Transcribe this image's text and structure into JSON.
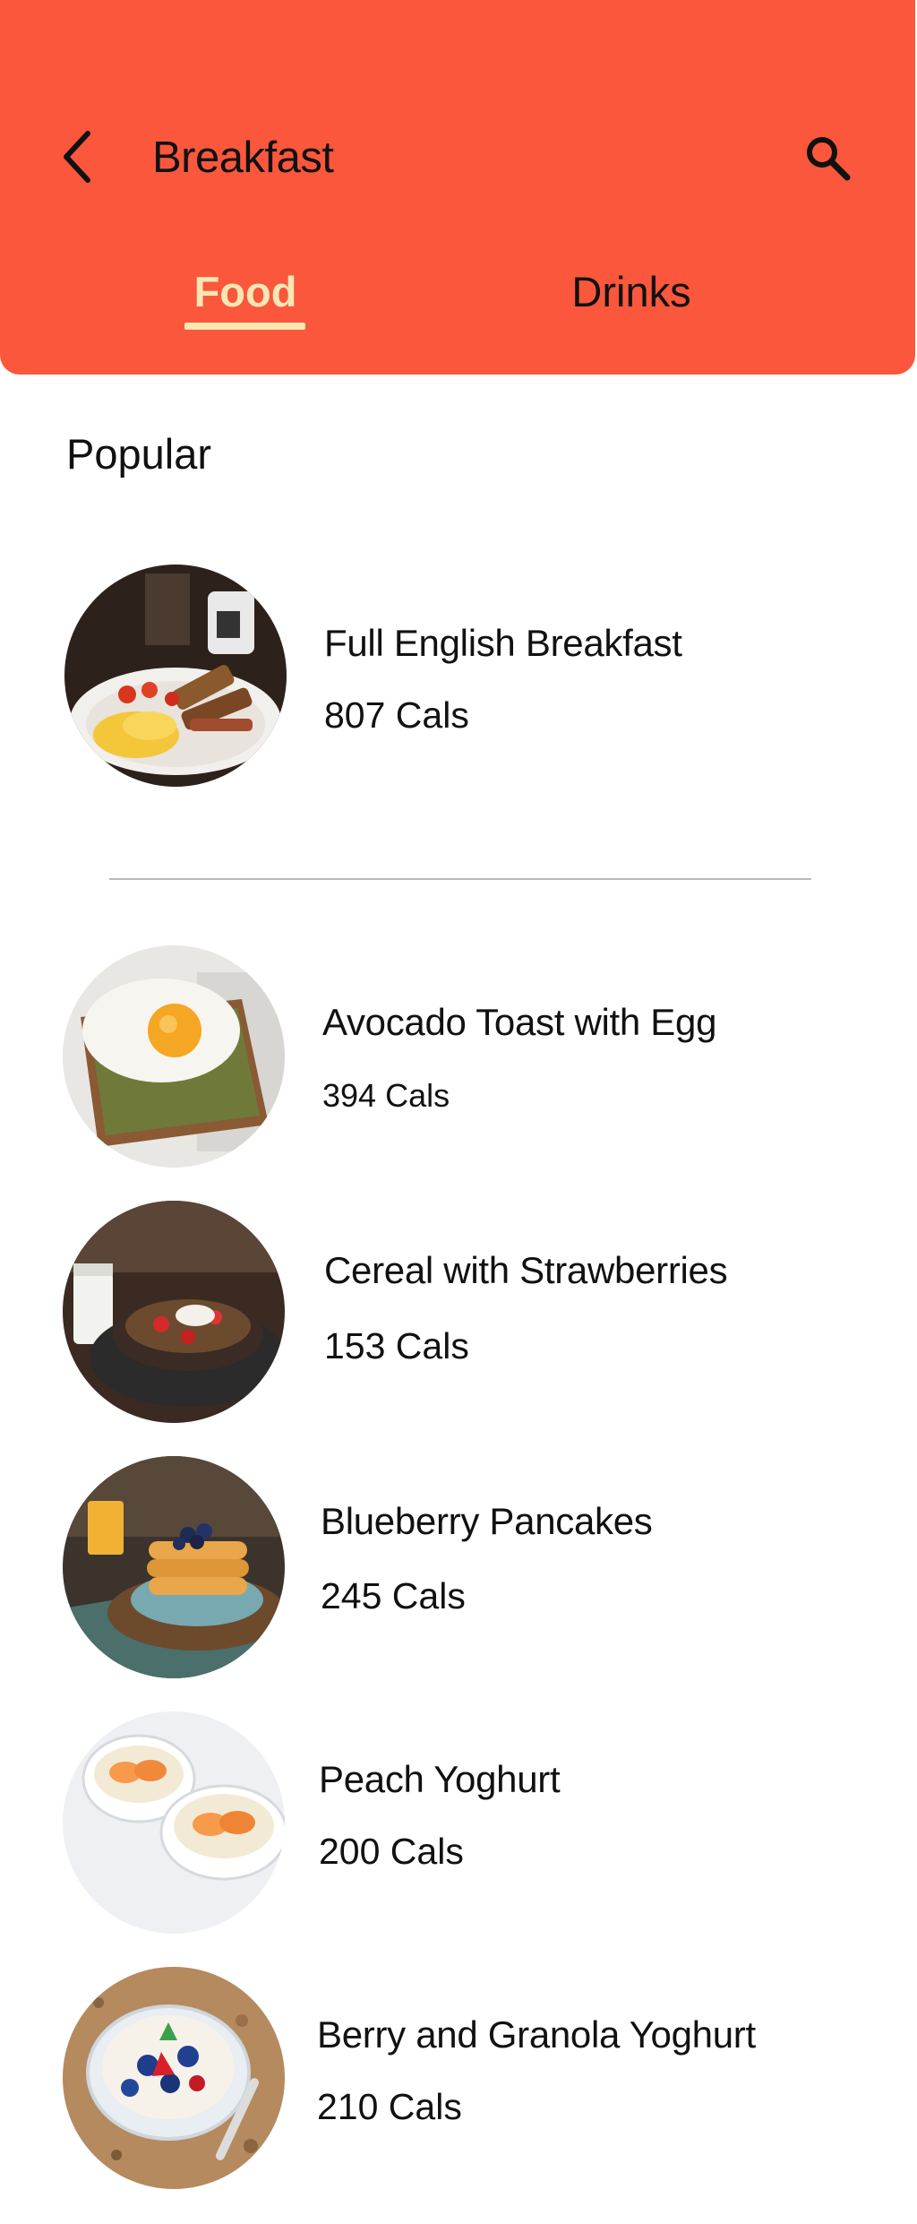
{
  "header": {
    "title": "Breakfast",
    "background_color": "#fa573c",
    "back_icon": "chevron-left-icon",
    "search_icon": "search-icon"
  },
  "tabs": [
    {
      "label": "Food",
      "selected": true
    },
    {
      "label": "Drinks",
      "selected": false
    }
  ],
  "accent_color": "#f6e7b3",
  "section": {
    "title": "Popular"
  },
  "featured": {
    "name": "Full English Breakfast",
    "cals": "807 Cals"
  },
  "items": [
    {
      "name": "Avocado Toast with Egg",
      "cals": "394 Cals"
    },
    {
      "name": "Cereal with Strawberries",
      "cals": "153 Cals"
    },
    {
      "name": "Blueberry Pancakes",
      "cals": "245 Cals"
    },
    {
      "name": "Peach Yoghurt",
      "cals": "200 Cals"
    },
    {
      "name": "Berry and Granola Yoghurt",
      "cals": "210 Cals"
    }
  ]
}
